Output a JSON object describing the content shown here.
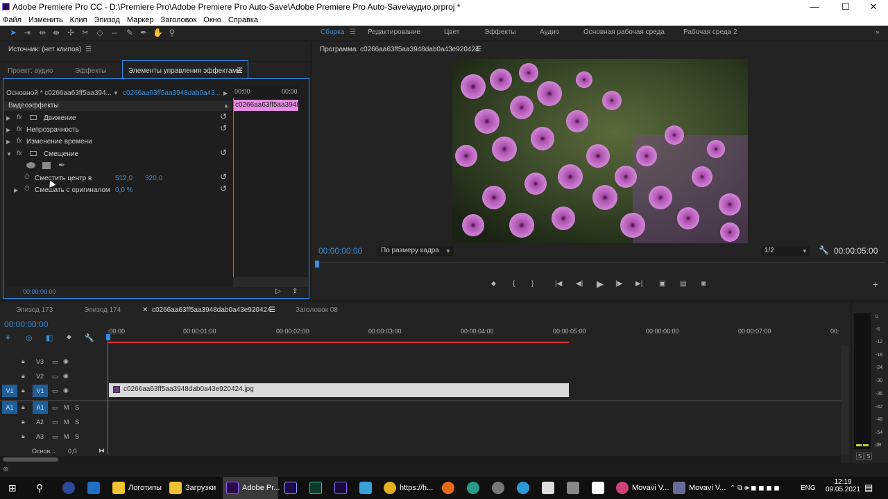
{
  "window": {
    "title": "Adobe Premiere Pro CC - D:\\Premiere Pro\\Adobe Premiere Pro Auto-Save\\Adobe Premiere Pro Auto-Save\\аудио.prproj *"
  },
  "menu": [
    "Файл",
    "Изменить",
    "Клип",
    "Эпизод",
    "Маркер",
    "Заголовок",
    "Окно",
    "Справка"
  ],
  "workspaces": [
    "Сборка",
    "Редактирование",
    "Цвет",
    "Эффекты",
    "Аудио",
    "Основная рабочая среда",
    "Рабочая среда 2"
  ],
  "source": {
    "title": "Источник: (нет клипов)"
  },
  "left_tabs": [
    "Проект: аудио",
    "Эффекты",
    "Элементы управления эффектами"
  ],
  "effects": {
    "master": "Основной * c0266aa63ff5aa394...",
    "clip": "c0266aa63ff5aa3948dab0a43...",
    "section": "Видеоэффекты",
    "items": [
      "Движение",
      "Непрозрачность",
      "Изменение времени",
      "Смещение"
    ],
    "param1": {
      "label": "Сместить центр в",
      "x": "512,0",
      "y": "320,0"
    },
    "param2": {
      "label": "Смешать с оригиналом",
      "value": "0,0 %"
    },
    "mini_time_a": "00:00",
    "mini_time_b": "00:00",
    "mini_clip": "c0266aa63ff5aa3948d",
    "timecode": "00:00:00:00"
  },
  "program": {
    "title": "Программа: c0266aa63ff5aa3948dab0a43e920424",
    "timecode": "00:00:00:00",
    "fit": "По размеру кадра",
    "res": "1/2",
    "duration": "00:00:05:00"
  },
  "timeline": {
    "tabs": [
      "Эпизод 173",
      "Эпизод 174",
      "c0266aa63ff5aa3948dab0a43e920424",
      "Заголовок 08"
    ],
    "timecode": "00:00:00:00",
    "ruler": [
      ":00:00",
      "00:00:01:00",
      "00:00:02:00",
      "00:00:03:00",
      "00:00:04:00",
      "00:00:05:00",
      "00:00:06:00",
      "00:00:07:00",
      "00:"
    ],
    "clip": "c0266aa63ff5aa3948dab0a43e920424.jpg",
    "video_tracks": [
      "V3",
      "V2",
      "V1"
    ],
    "audio_tracks": [
      "A1",
      "A2",
      "A3"
    ],
    "master": {
      "label": "Основ...",
      "value": "0,0"
    },
    "src_v": "V1",
    "src_a": "A1"
  },
  "meter": {
    "labels": [
      "0",
      "-6",
      "-12",
      "-18",
      "-24",
      "-30",
      "-36",
      "-42",
      "-48",
      "-54",
      "dB"
    ],
    "solo": [
      "S",
      "S"
    ]
  },
  "taskbar": {
    "items": [
      "Логотипы",
      "Загрузки",
      "Adobe Pr...",
      "https://h...",
      "Movavi V...",
      "Movavi V..."
    ],
    "lang": "ENG",
    "time": "12:19",
    "date": "09.05.2021"
  }
}
